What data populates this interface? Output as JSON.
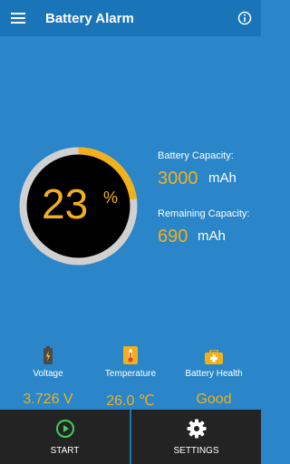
{
  "appbar": {
    "title": "Battery Alarm",
    "menu_icon": "menu-icon",
    "info_icon": "info-icon"
  },
  "gauge": {
    "percent": 23,
    "percent_text": "23",
    "unit": "%"
  },
  "capacity": {
    "label": "Battery Capacity:",
    "value": "3000",
    "unit": "mAh"
  },
  "remaining": {
    "label": "Remaining Capacity:",
    "value": "690",
    "unit": "mAh"
  },
  "stats": [
    {
      "label": "Voltage",
      "value": "3.726 V",
      "icon": "battery-icon"
    },
    {
      "label": "Temperature",
      "value": "26.0 ℃",
      "icon": "thermometer-icon"
    },
    {
      "label": "Battery Health",
      "value": "Good",
      "icon": "health-kit-icon"
    }
  ],
  "bottom": {
    "start_label": "START",
    "settings_label": "SETTINGS"
  },
  "colors": {
    "accent": "#f2b01b",
    "background": "#2a86c8",
    "appbar": "#1a74b8",
    "bottom_bar": "#232323"
  }
}
